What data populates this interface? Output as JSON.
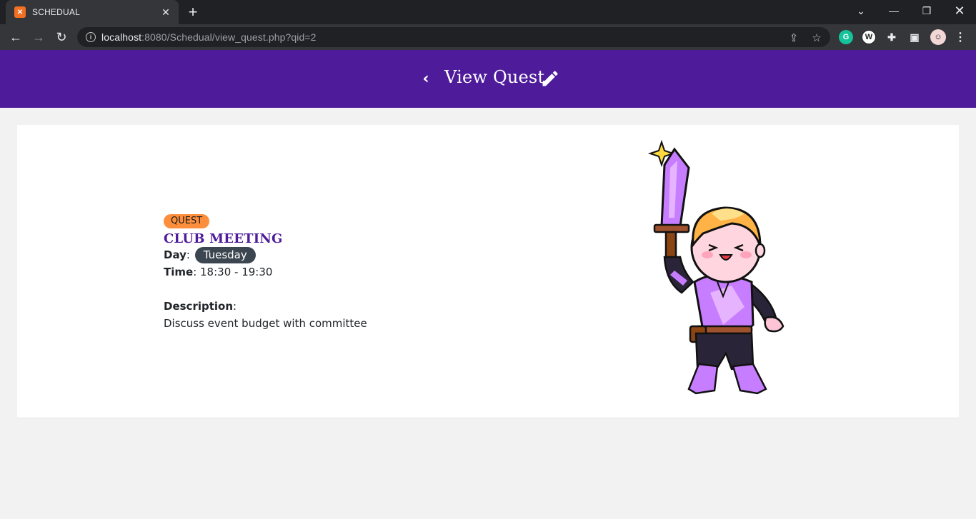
{
  "browser": {
    "tab_title": "SCHEDUAL",
    "tab_favicon_text": "⌘",
    "url_host": "localhost",
    "url_rest": ":8080/Schedual/view_quest.php?qid=2"
  },
  "header": {
    "title": "View Quest"
  },
  "quest": {
    "badge": "QUEST",
    "name": "CLUB MEETING",
    "day_label": "Day",
    "day_value": "Tuesday",
    "time_label": "Time",
    "time_value": "18:30 - 19:30",
    "description_label": "Description",
    "description_value": "Discuss event budget with committee"
  },
  "colors": {
    "header_bg": "#4e1c9a",
    "badge_bg": "#fd8f3c",
    "day_pill_bg": "#3c4650",
    "title_color": "#4e1c9a"
  }
}
